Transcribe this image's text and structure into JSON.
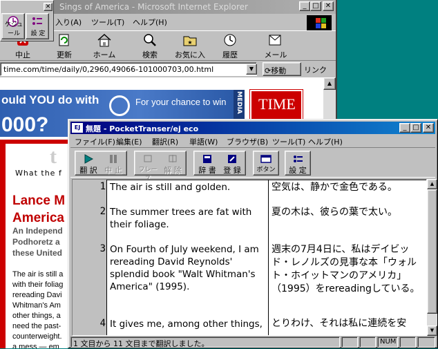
{
  "ie": {
    "title": "Sings of America - Microsoft Internet Explorer",
    "menu": [
      "入り(A)",
      "ツール(T)",
      "ヘルプ(H)"
    ],
    "toolbar": [
      "中止",
      "更新",
      "ホーム",
      "検索",
      "お気に入り",
      "履歴",
      "メール"
    ],
    "address": "time.com/time/daily/0,2960,49066-101000703,00.html",
    "go_label": "移動",
    "links_label": "リンク"
  },
  "mini_toolbar": {
    "b1": "ケジュール",
    "b2": "設 定"
  },
  "page": {
    "banner_line1": "ould YOU do with",
    "banner_line2": "000?",
    "banner_chance": "For your chance to win",
    "media_label": "MEDIA",
    "time_logo": "TIME",
    "t_letter": "t",
    "what_the": "What the f",
    "headline": [
      "Lance M",
      "America"
    ],
    "subhead": [
      "An Independ",
      "Podhoretz a",
      "these United"
    ],
    "body_lines": [
      "The air is still a",
      "with their foliag",
      "rereading Davi",
      "Whitman's Am",
      "other things, a",
      "need the past-",
      "counterweight.",
      "a mess — em"
    ]
  },
  "pt": {
    "title": "無題 - PocketTranser/ej eco",
    "app_icon": "EJ",
    "menu": [
      "ファイル(F)",
      "編集(E)",
      "翻訳(R)",
      "単語(W)",
      "ブラウザ(B)",
      "ツール(T)",
      "ヘルプ(H)"
    ],
    "toolbar": {
      "translate": "翻 訳",
      "stop": "中 止",
      "phrase": "フレーズ",
      "release": "解 除",
      "dictionary": "辞 書",
      "register": "登 録",
      "button": "ボタン",
      "settings": "設 定"
    },
    "rows": [
      {
        "n": "1",
        "src": "The air is still and golden.",
        "tgt": "空気は、静かで金色である。"
      },
      {
        "n": "2",
        "src": "The summer trees are fat with their foliage.",
        "tgt": "夏の木は、彼らの葉で太い。"
      },
      {
        "n": "3",
        "src": "On Fourth of July weekend, I am rereading David Reynolds' splendid book \"Walt Whitman's America\" (1995).",
        "tgt": "週末の7月4日に、私はデイビッド・レノルズの見事な本「ウォルト・ホイットマンのアメリカ」（1995）をrereadingしている。"
      },
      {
        "n": "4",
        "src": "It gives me, among other things,",
        "tgt": "とりわけ、それは私に連続を安"
      }
    ],
    "status": "1 文目から 11 文目まで翻訳しました。",
    "status_num": "NUM"
  }
}
